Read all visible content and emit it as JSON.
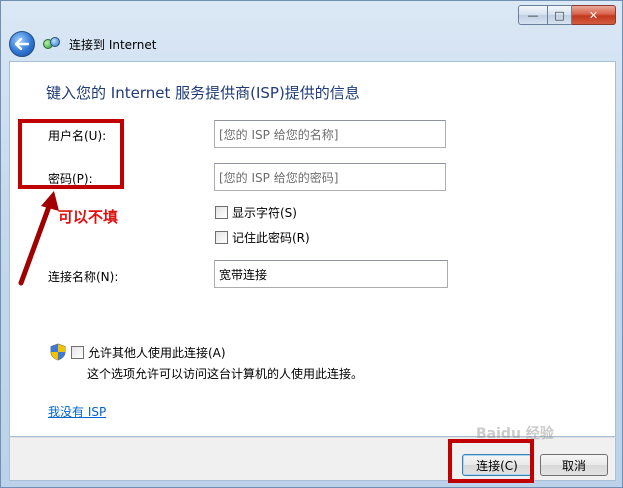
{
  "window": {
    "title": "连接到 Internet",
    "controls": {
      "minimize": "—",
      "maximize": "□",
      "close": "✕"
    }
  },
  "heading": "键入您的 Internet 服务提供商(ISP)提供的信息",
  "form": {
    "username_label": "用户名(U):",
    "username_placeholder": "[您的 ISP 给您的名称]",
    "password_label": "密码(P):",
    "password_placeholder": "[您的 ISP 给您的密码]",
    "show_chars_label": "显示字符(S)",
    "remember_password_label": "记住此密码(R)",
    "connection_name_label": "连接名称(N):",
    "connection_name_value": "宽带连接"
  },
  "allow_others": {
    "label": "允许其他人使用此连接(A)",
    "description": "这个选项允许可以访问这台计算机的人使用此连接。"
  },
  "no_isp_link": "我没有 ISP",
  "buttons": {
    "connect": "连接(C)",
    "cancel": "取消"
  },
  "annotation": {
    "text": "可以不填",
    "color": "#c00000"
  },
  "watermark": "Baidu 经验"
}
